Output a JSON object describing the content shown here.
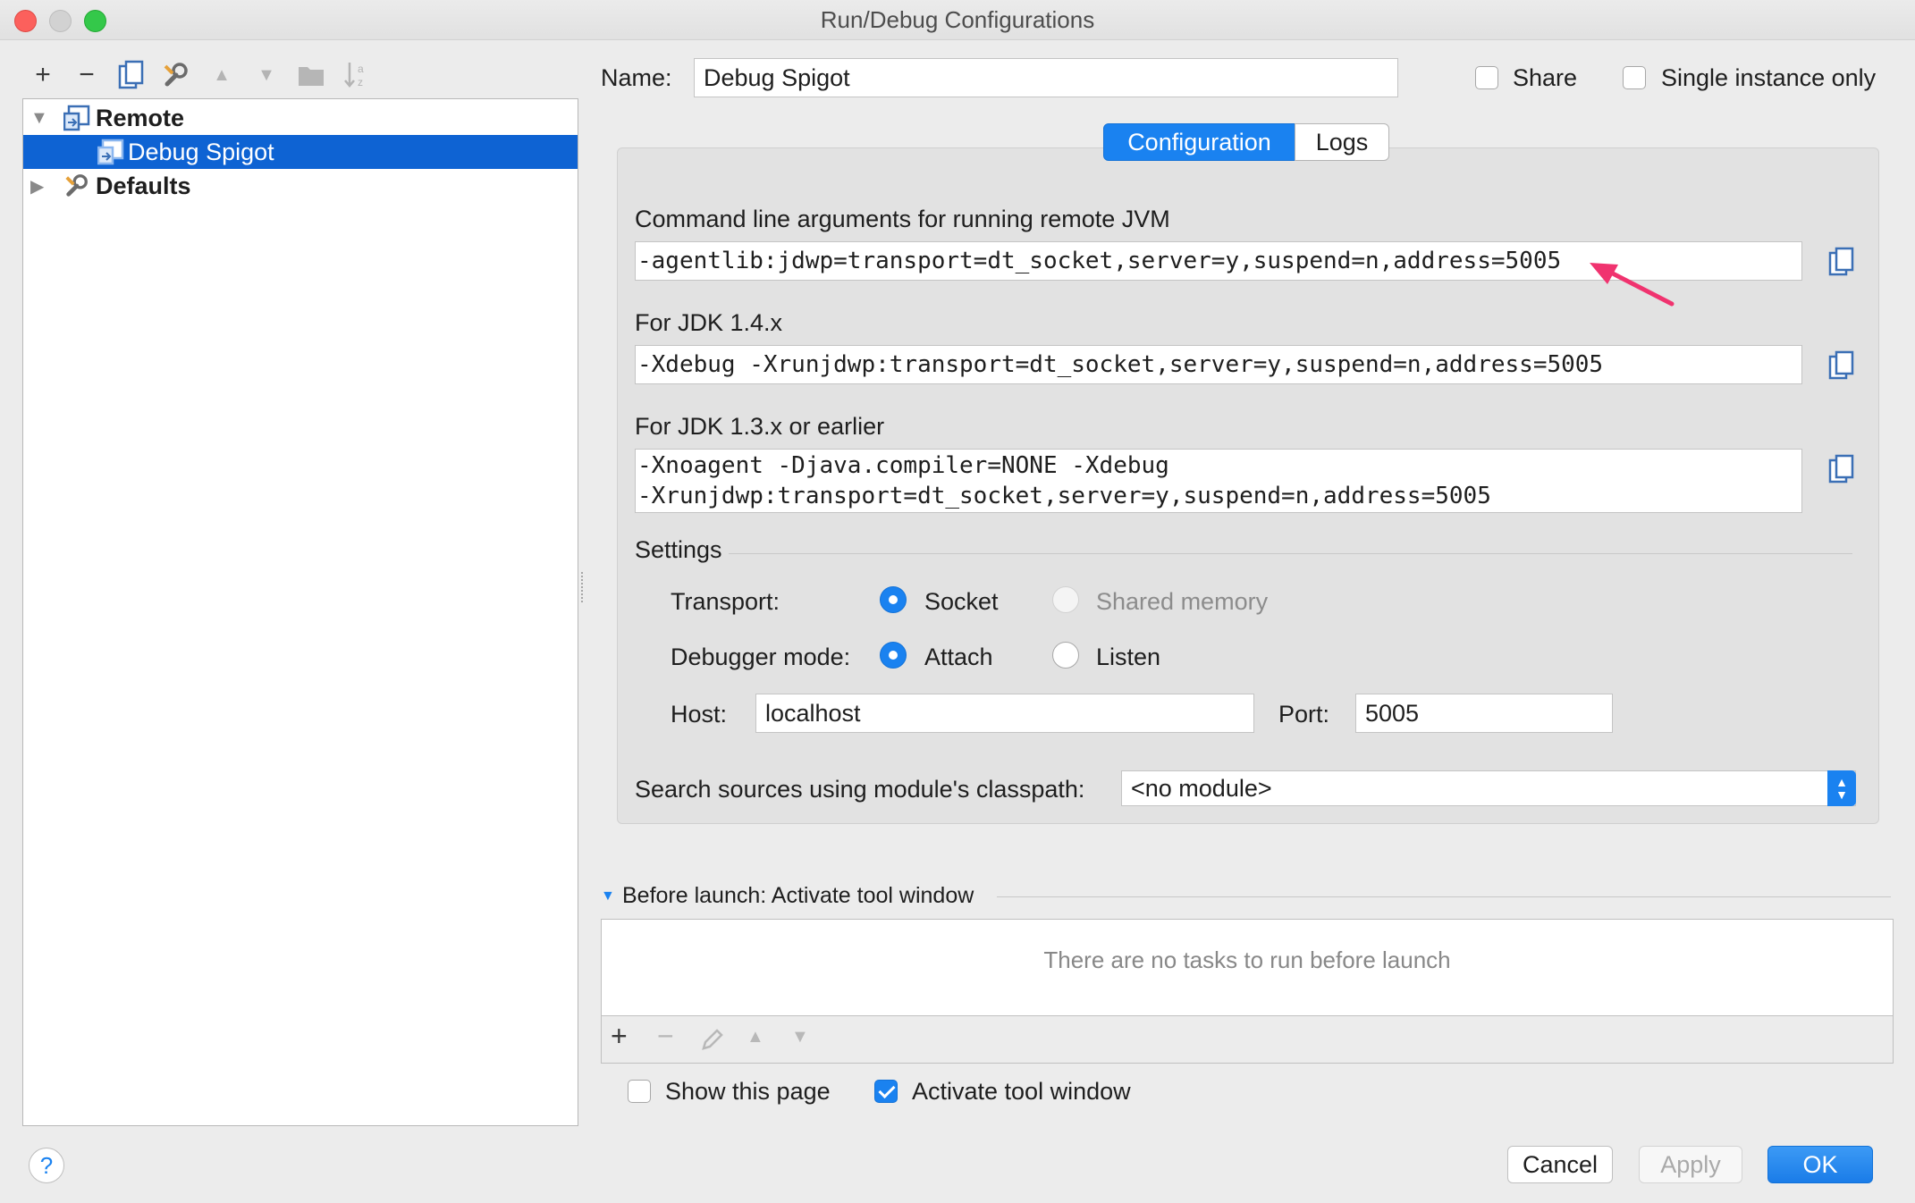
{
  "window": {
    "title": "Run/Debug Configurations"
  },
  "toolbar": {
    "add": "+",
    "remove": "−"
  },
  "tree": {
    "items": [
      {
        "label": "Remote",
        "expanded": true
      },
      {
        "label": "Debug Spigot",
        "selected": true
      },
      {
        "label": "Defaults",
        "expanded": false
      }
    ]
  },
  "header": {
    "name_label": "Name:",
    "name_value": "Debug Spigot",
    "share_label": "Share",
    "share_checked": false,
    "single_instance_label": "Single instance only",
    "single_instance_checked": false
  },
  "tabs": [
    {
      "label": "Configuration",
      "active": true
    },
    {
      "label": "Logs",
      "active": false
    }
  ],
  "config": {
    "cmd_label": "Command line arguments for running remote JVM",
    "cmd_value": "-agentlib:jdwp=transport=dt_socket,server=y,suspend=n,address=5005",
    "jdk14_label": "For JDK 1.4.x",
    "jdk14_value": "-Xdebug -Xrunjdwp:transport=dt_socket,server=y,suspend=n,address=5005",
    "jdk13_label": "For JDK 1.3.x or earlier",
    "jdk13_line1": "-Xnoagent -Djava.compiler=NONE -Xdebug",
    "jdk13_line2": "-Xrunjdwp:transport=dt_socket,server=y,suspend=n,address=5005"
  },
  "settings": {
    "title": "Settings",
    "transport_label": "Transport:",
    "transport_options": [
      {
        "label": "Socket",
        "selected": true,
        "enabled": true
      },
      {
        "label": "Shared memory",
        "selected": false,
        "enabled": false
      }
    ],
    "mode_label": "Debugger mode:",
    "mode_options": [
      {
        "label": "Attach",
        "selected": true
      },
      {
        "label": "Listen",
        "selected": false
      }
    ],
    "host_label": "Host:",
    "host_value": "localhost",
    "port_label": "Port:",
    "port_value": "5005",
    "module_label": "Search sources using module's classpath:",
    "module_value": "<no module>"
  },
  "before_launch": {
    "title": "Before launch: Activate tool window",
    "empty_text": "There are no tasks to run before launch",
    "add": "+",
    "remove": "−"
  },
  "footer": {
    "show_page_label": "Show this page",
    "show_page_checked": false,
    "activate_label": "Activate tool window",
    "activate_checked": true,
    "help": "?",
    "cancel": "Cancel",
    "apply": "Apply",
    "ok": "OK"
  },
  "colors": {
    "accent": "#1a82f0",
    "selection": "#0e63d3",
    "annotation_arrow": "#f0336f"
  }
}
